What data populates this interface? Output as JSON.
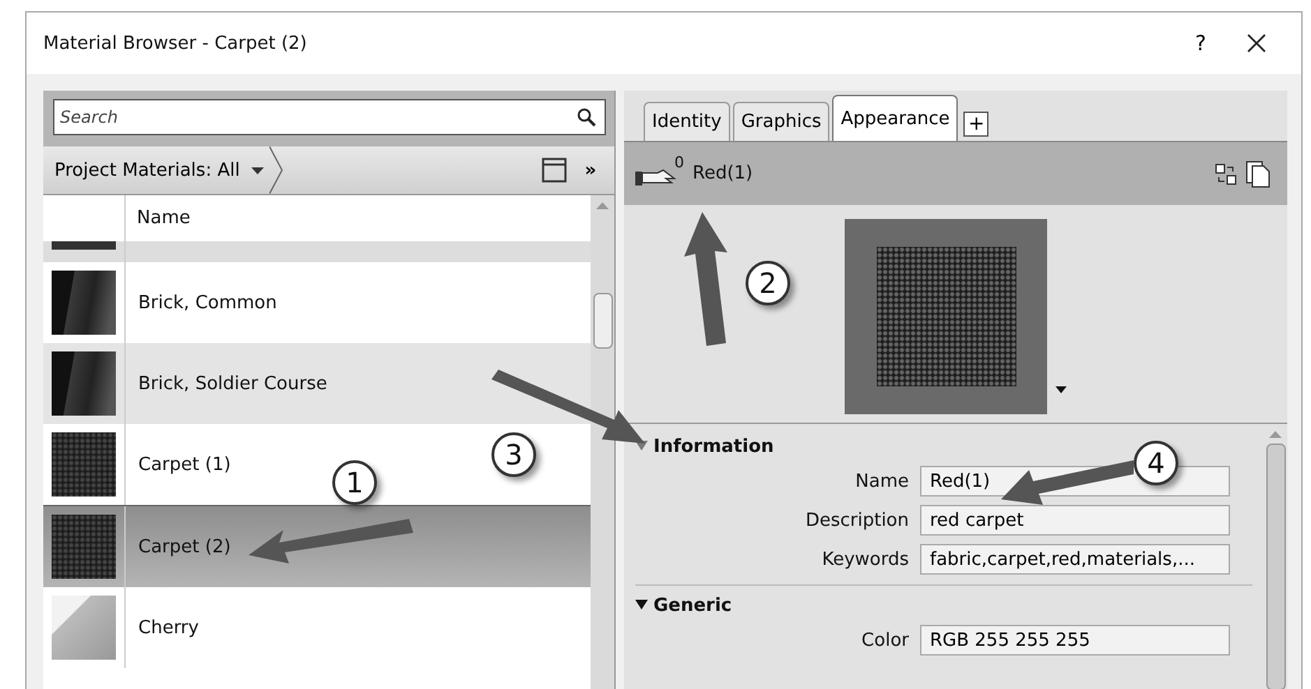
{
  "window": {
    "title": "Material Browser - Carpet (2)",
    "help": "?"
  },
  "search": {
    "placeholder": "Search"
  },
  "library_bar": {
    "label": "Project Materials: All",
    "more": "»"
  },
  "table": {
    "columns": [
      "Name"
    ],
    "rows": [
      {
        "name": "Brick, Common",
        "kind": "brick",
        "selected": false
      },
      {
        "name": "Brick, Soldier Course",
        "kind": "brick",
        "selected": false
      },
      {
        "name": "Carpet (1)",
        "kind": "carpet",
        "selected": false
      },
      {
        "name": "Carpet (2)",
        "kind": "carpet",
        "selected": true
      },
      {
        "name": "Cherry",
        "kind": "cube",
        "selected": false
      }
    ]
  },
  "tabs": [
    {
      "label": "Identity",
      "selected": false
    },
    {
      "label": "Graphics",
      "selected": false
    },
    {
      "label": "Appearance",
      "selected": true
    }
  ],
  "add_tab": "+",
  "asset": {
    "users": "0",
    "name": "Red(1)"
  },
  "sections": [
    {
      "title": "Information",
      "expanded": true,
      "fields": [
        {
          "label": "Name",
          "value": "Red(1)"
        },
        {
          "label": "Description",
          "value": "red carpet"
        },
        {
          "label": "Keywords",
          "value": "fabric,carpet,red,materials,..."
        }
      ]
    },
    {
      "title": "Generic",
      "expanded": true,
      "fields": [
        {
          "label": "Color",
          "value": "RGB 255 255 255"
        }
      ]
    }
  ],
  "callouts": [
    {
      "number": "1"
    },
    {
      "number": "2"
    },
    {
      "number": "3"
    },
    {
      "number": "4"
    }
  ]
}
